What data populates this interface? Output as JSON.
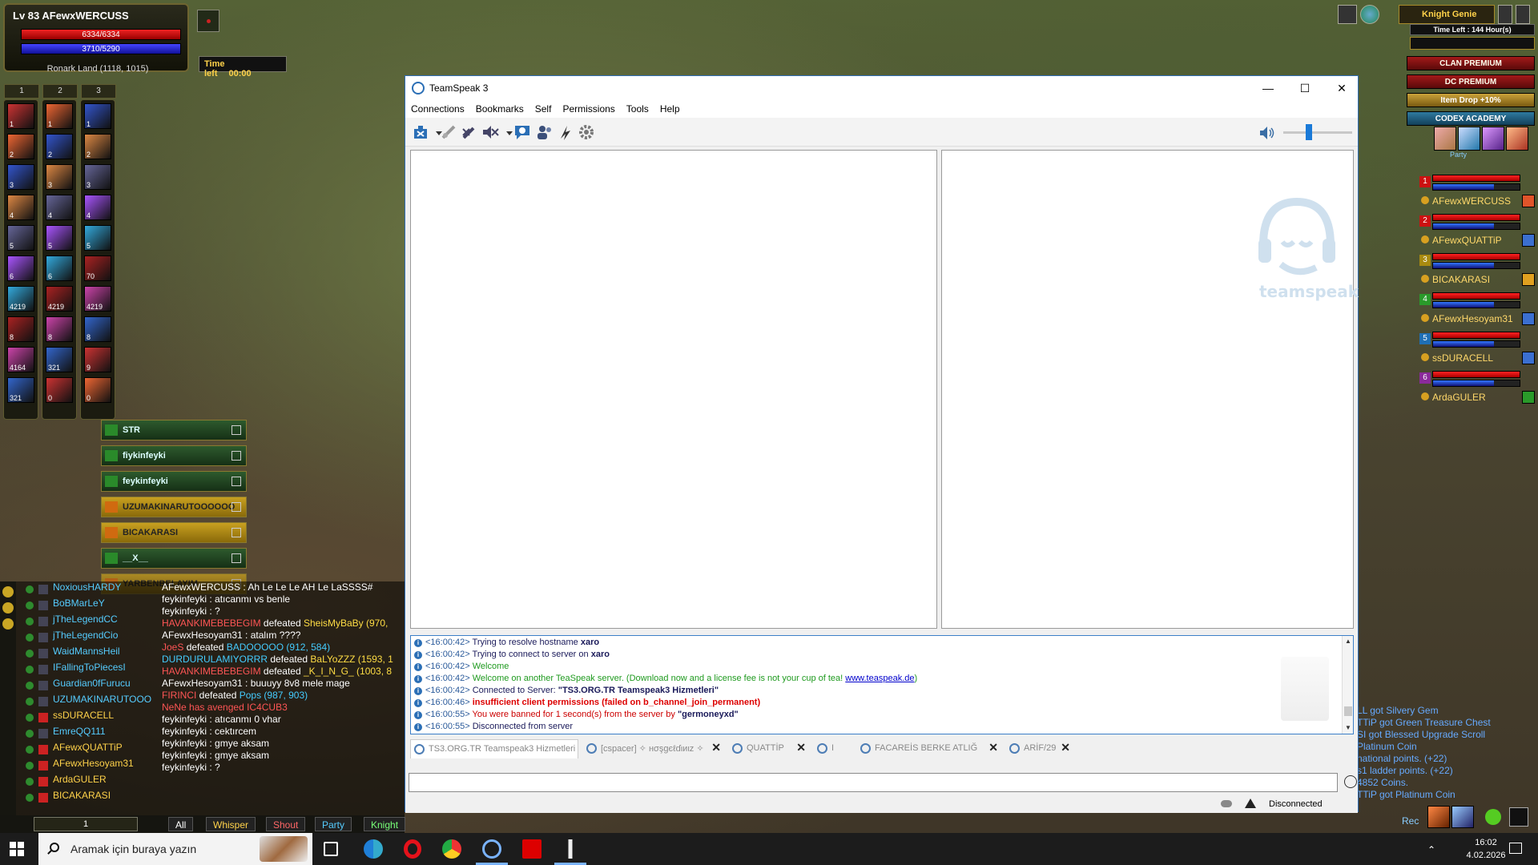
{
  "game": {
    "character": {
      "level_name": "Lv 83 AFewxWERCUSS",
      "hp": "6334/6334",
      "mp": "3710/5290",
      "location": "Ronark Land (1118, 1015)"
    },
    "time_left": {
      "label": "Time left",
      "value": "00:00"
    },
    "skillbars": [
      {
        "page": "1",
        "counts": [
          "1",
          "2",
          "3",
          "4",
          "5",
          "6",
          "4219",
          "8",
          "4164",
          "321"
        ]
      },
      {
        "page": "2",
        "counts": [
          "1",
          "2",
          "3",
          "4",
          "5",
          "6",
          "4219",
          "8",
          "321",
          "0"
        ]
      },
      {
        "page": "3",
        "counts": [
          "1",
          "2",
          "3",
          "4",
          "5",
          "70",
          "4219",
          "8",
          "9",
          "0"
        ]
      }
    ],
    "clan_members": [
      {
        "name": "STR",
        "style": "green"
      },
      {
        "name": "fiykinfeyki",
        "style": "green"
      },
      {
        "name": "feykinfeyki",
        "style": "green"
      },
      {
        "name": "UZUMAKINARUTOOOOOO",
        "style": "gold"
      },
      {
        "name": "BICAKARASI",
        "style": "gold"
      },
      {
        "name": "__X__",
        "style": "green"
      },
      {
        "name": "YARBENBELAYIM",
        "style": "dim"
      }
    ],
    "chat_names": [
      {
        "name": "NoxiousHARDY",
        "color": "#5cf"
      },
      {
        "name": "BoBMarLeY",
        "color": "#5cf"
      },
      {
        "name": "jTheLegendCC",
        "color": "#5cf"
      },
      {
        "name": "jTheLegendCio",
        "color": "#5cf"
      },
      {
        "name": "WaidMannsHeil",
        "color": "#5cf"
      },
      {
        "name": "IFallingToPiecesI",
        "color": "#5cf"
      },
      {
        "name": "Guardian0fFurucu",
        "color": "#5cf"
      },
      {
        "name": "UZUMAKINARUTOOO",
        "color": "#5cf"
      },
      {
        "name": "ssDURACELL",
        "color": "#ffd24a"
      },
      {
        "name": "EmreQQ111",
        "color": "#5cf"
      },
      {
        "name": "AFewxQUATTiP",
        "color": "#ffd24a"
      },
      {
        "name": "AFewxHesoyam31",
        "color": "#ffd24a"
      },
      {
        "name": "ArdaGULER",
        "color": "#ffd24a"
      },
      {
        "name": "BICAKARASI",
        "color": "#ffd24a"
      }
    ],
    "chat_messages": [
      {
        "parts": [
          {
            "t": "AFewxWERCUSS : Ah Le Le Le AH Le LaSSSS#",
            "c": ""
          }
        ]
      },
      {
        "parts": [
          {
            "t": "feykinfeyki : atıcanmı vs benle",
            "c": ""
          }
        ]
      },
      {
        "parts": [
          {
            "t": "feykinfeyki : ?",
            "c": ""
          }
        ]
      },
      {
        "parts": [
          {
            "t": " HAVANKIMEBEBEGIM",
            "c": "r"
          },
          {
            "t": " defeated ",
            "c": ""
          },
          {
            "t": "SheisMyBaBy (970,",
            "c": "y"
          }
        ]
      },
      {
        "parts": [
          {
            "t": "AFewxHesoyam31 : atalım ????",
            "c": ""
          }
        ]
      },
      {
        "parts": [
          {
            "t": " JoeS",
            "c": "r"
          },
          {
            "t": " defeated ",
            "c": ""
          },
          {
            "t": "BADOOOOO (912, 584)",
            "c": "c"
          }
        ]
      },
      {
        "parts": [
          {
            "t": " DURDURULAMIYORRR",
            "c": "c"
          },
          {
            "t": " defeated ",
            "c": ""
          },
          {
            "t": "BaLYoZZZ (1593, 1",
            "c": "y"
          }
        ]
      },
      {
        "parts": [
          {
            "t": " HAVANKIMEBEBEGIM",
            "c": "r"
          },
          {
            "t": " defeated ",
            "c": ""
          },
          {
            "t": "_K_I_N_G_ (1003, 8",
            "c": "y"
          }
        ]
      },
      {
        "parts": [
          {
            "t": "AFewxHesoyam31 : buuuyy 8v8 mele mage",
            "c": ""
          }
        ]
      },
      {
        "parts": [
          {
            "t": " FIRINCI",
            "c": "r"
          },
          {
            "t": " defeated ",
            "c": ""
          },
          {
            "t": "Pops (987, 903)",
            "c": "c"
          }
        ]
      },
      {
        "parts": [
          {
            "t": "NeNe has avenged IC4CUB3",
            "c": "r"
          }
        ]
      },
      {
        "parts": [
          {
            "t": "feykinfeyki : atıcanmı 0 vhar",
            "c": ""
          }
        ]
      },
      {
        "parts": [
          {
            "t": "feykinfeyki : cektırcem",
            "c": ""
          }
        ]
      },
      {
        "parts": [
          {
            "t": "feykinfeyki : gmye aksam",
            "c": ""
          }
        ]
      },
      {
        "parts": [
          {
            "t": "feykinfeyki : gmye aksam",
            "c": ""
          }
        ]
      },
      {
        "parts": [
          {
            "t": "feykinfeyki : ?",
            "c": ""
          }
        ]
      }
    ],
    "chat_page": "1",
    "chat_tabs": [
      {
        "label": "All",
        "color": "#fff"
      },
      {
        "label": "Whisper",
        "color": "#ffd24a"
      },
      {
        "label": "Shout",
        "color": "#f66"
      },
      {
        "label": "Party",
        "color": "#5cf"
      },
      {
        "label": "Knight",
        "color": "#7f7"
      }
    ],
    "genie": {
      "label": "Knight Genie",
      "time_left": "Time Left : 144 Hour(s)"
    },
    "promos": [
      {
        "label": "CLAN PREMIUM",
        "style": "red"
      },
      {
        "label": "DC PREMIUM",
        "style": "red"
      },
      {
        "label": "Item Drop +10%",
        "style": "gold"
      },
      {
        "label": "CODEX ACADEMY",
        "style": "blue"
      }
    ],
    "party_label": "Party",
    "party": [
      {
        "num": "1",
        "name": "AFewxWERCUSS",
        "num_color": "#c11",
        "cls_color": "#e0542a"
      },
      {
        "num": "2",
        "name": "AFewxQUATTiP",
        "num_color": "#c11",
        "cls_color": "#3b6fd0"
      },
      {
        "num": "3",
        "name": "BICAKARASI",
        "num_color": "#a88a10",
        "cls_color": "#e0a020"
      },
      {
        "num": "4",
        "name": "AFewxHesoyam31",
        "num_color": "#2a9a2a",
        "cls_color": "#3b6fd0"
      },
      {
        "num": "5",
        "name": "ssDURACELL",
        "num_color": "#1f6fb5",
        "cls_color": "#3b6fd0"
      },
      {
        "num": "6",
        "name": "ArdaGULER",
        "num_color": "#8a2a9a",
        "cls_color": "#2a9a2a"
      }
    ],
    "right_log": [
      "LL got Silvery Gem",
      "TTiP got Green Treasure Chest",
      "SI got Blessed Upgrade Scroll",
      "Platinum Coin",
      "national points. (+22)",
      "s1 ladder points. (+22)",
      "4852 Coins.",
      "TTiP got Platinum Coin"
    ],
    "rec_label": "Rec"
  },
  "teamspeak": {
    "title": "TeamSpeak 3",
    "menu": [
      "Connections",
      "Bookmarks",
      "Self",
      "Permissions",
      "Tools",
      "Help"
    ],
    "toolbar_icons": [
      "connect-icon",
      "disconnect-icon",
      "mute-microphone-icon",
      "mute-speakers-icon",
      "away-icon",
      "contacts-icon",
      "bookmark-icon",
      "settings-icon"
    ],
    "volume": 0.35,
    "logo_text": "teamspeak",
    "log": [
      {
        "time": "<16:00:42>",
        "parts": [
          {
            "t": " Trying to resolve hostname ",
            "c": "dark"
          },
          {
            "t": "xaro",
            "c": "dark b"
          }
        ]
      },
      {
        "time": "<16:00:42>",
        "parts": [
          {
            "t": " Trying to connect to server on ",
            "c": "dark"
          },
          {
            "t": "xaro",
            "c": "dark b"
          }
        ]
      },
      {
        "time": "<16:00:42>",
        "parts": [
          {
            "t": " Welcome",
            "c": "green"
          }
        ]
      },
      {
        "time": "<16:00:42>",
        "parts": [
          {
            "t": " Welcome on another TeaSpeak server. (Download now and a license fee is not your cup of tea! ",
            "c": "green"
          },
          {
            "t": "www.teaspeak.de",
            "c": "link"
          },
          {
            "t": ")",
            "c": "green"
          }
        ]
      },
      {
        "time": "<16:00:42>",
        "parts": [
          {
            "t": " Connected to Server: ",
            "c": "dark"
          },
          {
            "t": "\"TS3.ORG.TR Teamspeak3 Hizmetleri\"",
            "c": "dark b"
          }
        ]
      },
      {
        "time": "<16:00:46>",
        "parts": [
          {
            "t": " insufficient client permissions (failed on b_channel_join_permanent)",
            "c": "red"
          }
        ]
      },
      {
        "time": "<16:00:55>",
        "parts": [
          {
            "t": " You were banned for 1 second(s) from the server by ",
            "c": "lred"
          },
          {
            "t": "\"germoneyxd\"",
            "c": "dark b"
          }
        ]
      },
      {
        "time": "<16:00:55>",
        "parts": [
          {
            "t": " Disconnected from server",
            "c": "dark"
          }
        ]
      }
    ],
    "tabs": [
      {
        "label": "TS3.ORG.TR Teamspeak3 Hizmetleri",
        "active": true,
        "closable": false
      },
      {
        "label": "[cspacer] ✧ нσşgєℓɗιиιz ✧",
        "active": false,
        "closable": true
      },
      {
        "label": "QUATTİP",
        "active": false,
        "closable": true
      },
      {
        "label": "I",
        "active": false,
        "closable": false
      },
      {
        "label": "FACAREİS BERKE ATLIĞ",
        "active": false,
        "closable": true
      },
      {
        "label": "ARİF/29",
        "active": false,
        "closable": true
      }
    ],
    "status": "Disconnected"
  },
  "taskbar": {
    "search_placeholder": "Aramak için buraya yazın",
    "time": "16:02",
    "date": "4.02.2026",
    "apps": [
      "task-view-icon",
      "edge-icon",
      "opera-icon",
      "chrome-icon",
      "teamspeak-icon",
      "acrobat-icon",
      "knight-online-icon"
    ]
  }
}
